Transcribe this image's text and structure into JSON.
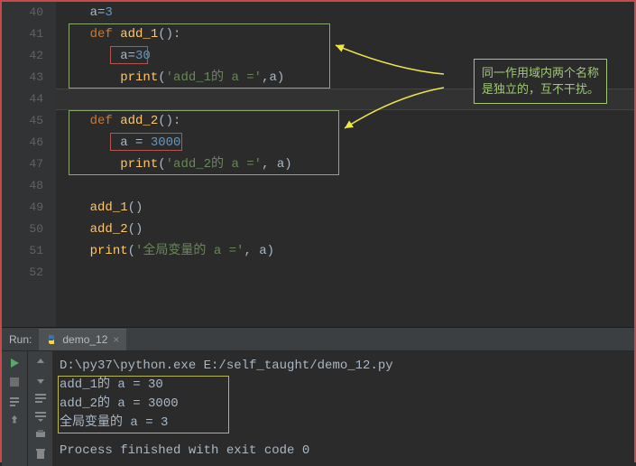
{
  "editor": {
    "line_start": 40,
    "lines": [
      {
        "n": 40,
        "indent": 1,
        "tokens": [
          [
            "id",
            "a"
          ],
          [
            "eq",
            "="
          ],
          [
            "num",
            "3"
          ]
        ]
      },
      {
        "n": 41,
        "indent": 1,
        "tokens": [
          [
            "kw",
            "def "
          ],
          [
            "fn",
            "add_1"
          ],
          [
            "id",
            "():"
          ]
        ]
      },
      {
        "n": 42,
        "indent": 2,
        "tokens": [
          [
            "id",
            "a"
          ],
          [
            "eq",
            "="
          ],
          [
            "num",
            "30"
          ]
        ]
      },
      {
        "n": 43,
        "indent": 2,
        "tokens": [
          [
            "fn",
            "print"
          ],
          [
            "id",
            "("
          ],
          [
            "str",
            "'add_1的 a ='"
          ],
          [
            "id",
            ",a)"
          ]
        ]
      },
      {
        "n": 44,
        "indent": 1,
        "tokens": []
      },
      {
        "n": 45,
        "indent": 1,
        "tokens": [
          [
            "kw",
            "def "
          ],
          [
            "fn",
            "add_2"
          ],
          [
            "id",
            "():"
          ]
        ]
      },
      {
        "n": 46,
        "indent": 2,
        "tokens": [
          [
            "id",
            "a "
          ],
          [
            "eq",
            "= "
          ],
          [
            "num",
            "3000"
          ]
        ]
      },
      {
        "n": 47,
        "indent": 2,
        "tokens": [
          [
            "fn",
            "print"
          ],
          [
            "id",
            "("
          ],
          [
            "str",
            "'add_2的 a ='"
          ],
          [
            "id",
            ", a)"
          ]
        ]
      },
      {
        "n": 48,
        "indent": 0,
        "tokens": []
      },
      {
        "n": 49,
        "indent": 1,
        "tokens": [
          [
            "fn",
            "add_1"
          ],
          [
            "id",
            "()"
          ]
        ]
      },
      {
        "n": 50,
        "indent": 1,
        "tokens": [
          [
            "fn",
            "add_2"
          ],
          [
            "id",
            "()"
          ]
        ]
      },
      {
        "n": 51,
        "indent": 1,
        "tokens": [
          [
            "fn",
            "print"
          ],
          [
            "id",
            "("
          ],
          [
            "str",
            "'全局变量的 a ='"
          ],
          [
            "id",
            ", a)"
          ]
        ]
      },
      {
        "n": 52,
        "indent": 0,
        "tokens": []
      }
    ],
    "caret_line_index": 4
  },
  "annotation": {
    "line1": "同一作用域内两个名称",
    "line2": "是独立的，互不干扰。"
  },
  "run": {
    "label": "Run:",
    "tab_label": "demo_12",
    "cmd": "D:\\py37\\python.exe E:/self_taught/demo_12.py",
    "output": [
      "add_1的 a = 30",
      "add_2的 a = 3000",
      "全局变量的 a = 3"
    ],
    "exit": "Process finished with exit code 0"
  },
  "icons": {
    "run": "run-icon",
    "stop": "stop-icon",
    "up": "up-arrow-icon",
    "down": "down-arrow-icon",
    "soft_wrap": "soft-wrap-icon",
    "scroll": "scroll-to-end-icon",
    "print": "print-icon",
    "pin": "pin-icon",
    "trash": "trash-icon",
    "step": "step-icon"
  }
}
